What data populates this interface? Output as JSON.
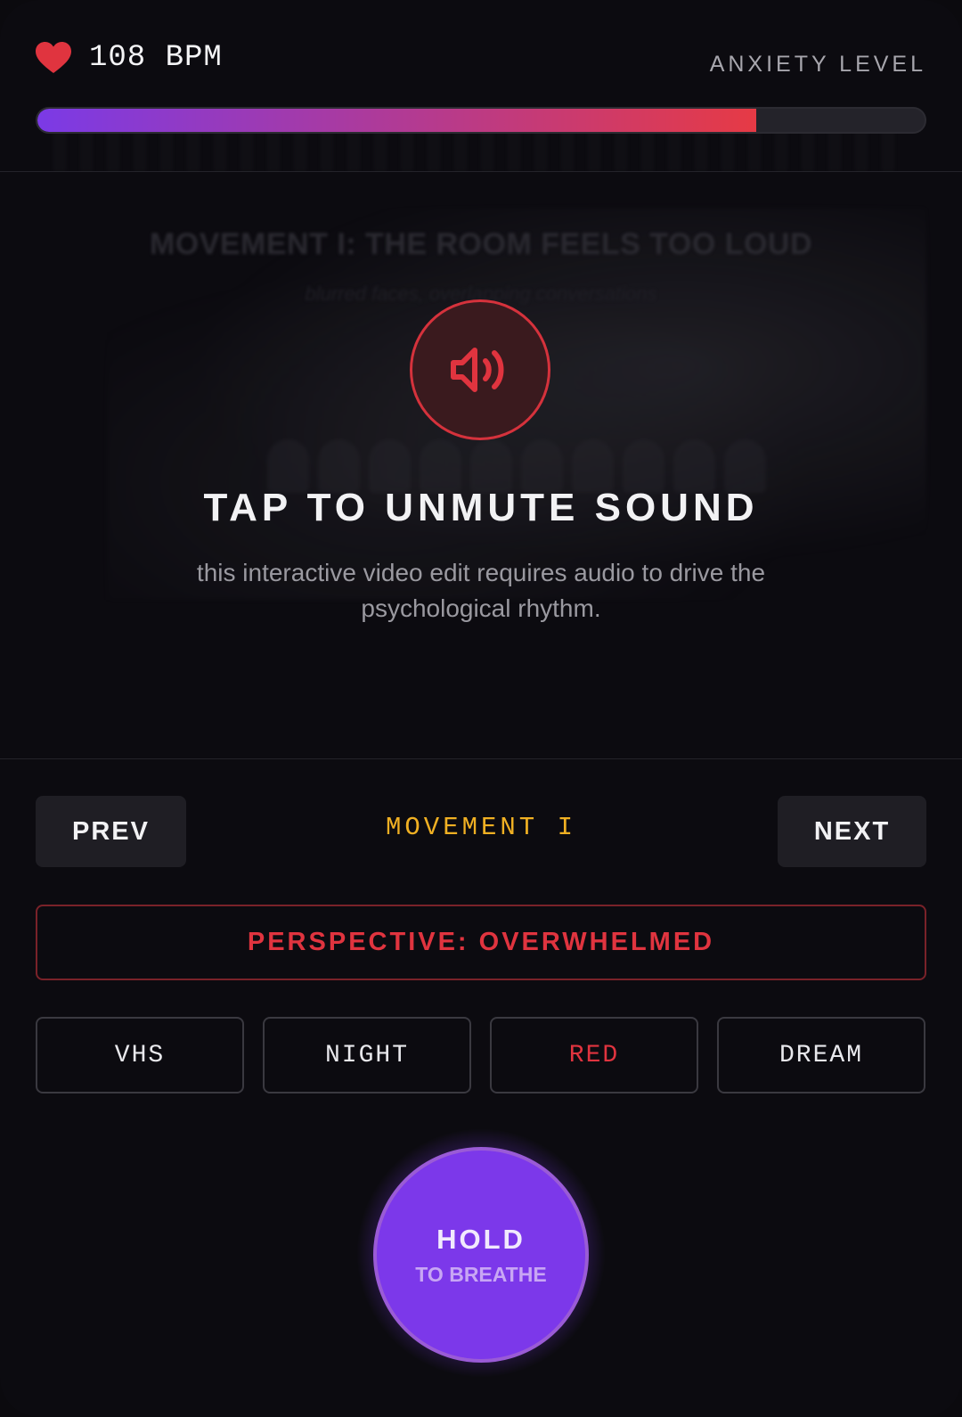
{
  "header": {
    "bpm_value": "108",
    "bpm_unit": "BPM",
    "bpm_text": "108 BPM",
    "anxiety_label": "ANXIETY LEVEL",
    "anxiety_level": 0.81,
    "meter_colors": [
      "#7b3ae6",
      "#e63a45"
    ]
  },
  "video": {
    "ghost_title": "MOVEMENT I: THE ROOM FEELS TOO LOUD",
    "ghost_subtitle": "blurred faces, overlapping conversations",
    "unmute_icon": "speaker-icon",
    "unmute_title": "TAP TO UNMUTE SOUND",
    "unmute_description": "this interactive video edit requires audio to drive the psychological rhythm."
  },
  "controls": {
    "prev_label": "PREV",
    "next_label": "NEXT",
    "movement_label": "MOVEMENT I",
    "perspective_label": "PERSPECTIVE: OVERWHELMED",
    "filters": [
      {
        "label": "VHS",
        "active": false
      },
      {
        "label": "NIGHT",
        "active": false
      },
      {
        "label": "RED",
        "active": true
      },
      {
        "label": "DREAM",
        "active": false
      }
    ]
  },
  "breathe": {
    "main_label": "HOLD",
    "sub_label": "TO BREATHE"
  },
  "colors": {
    "accent_red": "#e0343f",
    "accent_amber": "#f0b023",
    "accent_purple": "#7c38ea",
    "background": "#0c0b10"
  }
}
